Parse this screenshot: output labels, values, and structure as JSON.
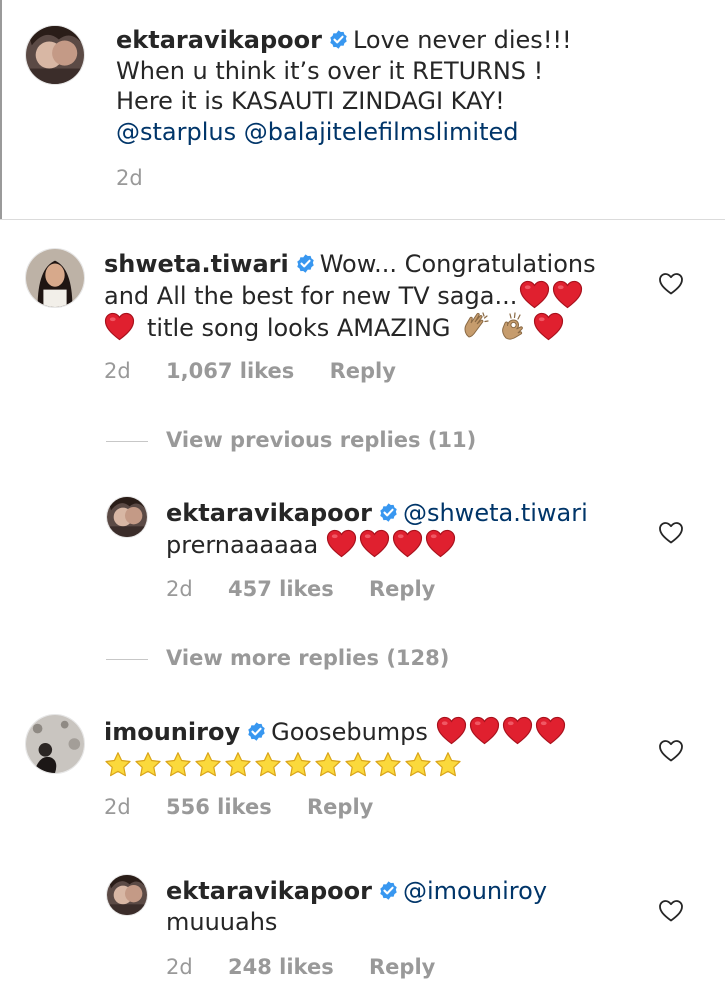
{
  "caption": {
    "username": "ektaravikapoor",
    "line1": "Love never dies!!!",
    "line2": "When u think it’s over it RETURNS !",
    "line3": "Here it is KASAUTI ZINDAGI KAY!",
    "mention1": "@starplus",
    "mention2": "@balajitelefilmslimited",
    "time": "2d"
  },
  "comments": [
    {
      "username": "shweta.tiwari",
      "line1": "Wow... Congratulations",
      "line2": "and All the best for new TV saga...",
      "line3": "title song looks AMAZING",
      "time": "2d",
      "likes": "1,067 likes",
      "reply": "Reply"
    },
    {
      "username": "ektaravikapoor",
      "mention": "@shweta.tiwari",
      "line2": "prernaaaaaa",
      "time": "2d",
      "likes": "457 likes",
      "reply": "Reply"
    },
    {
      "username": "imouniroy",
      "line1": "Goosebumps",
      "time": "2d",
      "likes": "556 likes",
      "reply": "Reply"
    },
    {
      "username": "ektaravikapoor",
      "mention": "@imouniroy",
      "line2": "muuuahs",
      "time": "2d",
      "likes": "248 likes",
      "reply": "Reply"
    }
  ],
  "view_previous": "View previous replies (11)",
  "view_more": "View more replies (128)",
  "icons": {
    "verified": "verified-badge-icon",
    "like": "heart-outline-icon",
    "heart_emoji": "red-heart-emoji",
    "star_emoji": "star-emoji",
    "clap_emoji": "clapping-hands-emoji",
    "ok_emoji": "ok-hand-emoji"
  },
  "colors": {
    "verified": "#3897f0",
    "heart": "#e0202f",
    "star": "#f8d12e",
    "mention": "#003569",
    "meta": "#999999"
  }
}
